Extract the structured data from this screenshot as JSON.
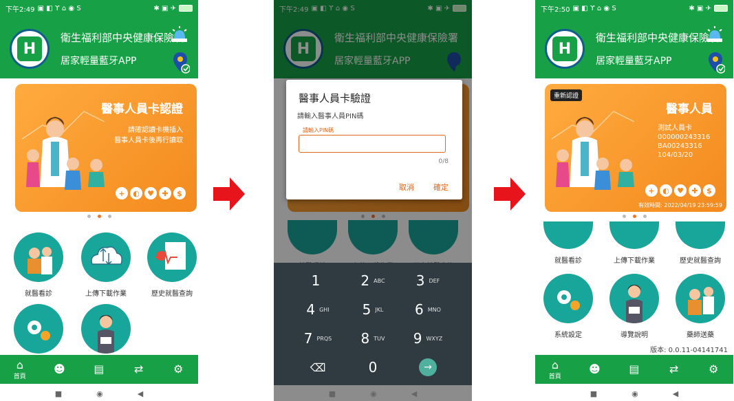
{
  "status": {
    "time_1": "下午2:49",
    "time_2": "下午2:49",
    "time_3": "下午2:50",
    "left_icons": "▣ ◧ ϒ ⌂ ◉ S",
    "right_icons": "✱ ▣ ✈"
  },
  "header": {
    "title": "衛生福利部中央健康保險署",
    "subtitle": "居家輕量藍牙APP",
    "logo_text": "H"
  },
  "screen1": {
    "card_title": "醫事人員卡認證",
    "card_line1": "請確認讀卡機插入",
    "card_line2": "醫事人員卡後再行讀取"
  },
  "screen2": {
    "dialog_title": "醫事人員卡驗證",
    "dialog_message": "請輸入醫事人員PIN碼",
    "input_label": "請輸入PIN碼",
    "char_count": "0/8",
    "cancel": "取消",
    "confirm": "確定",
    "keys": [
      {
        "num": "1",
        "letters": ""
      },
      {
        "num": "2",
        "letters": "ABC"
      },
      {
        "num": "3",
        "letters": "DEF"
      },
      {
        "num": "4",
        "letters": "GHI"
      },
      {
        "num": "5",
        "letters": "JKL"
      },
      {
        "num": "6",
        "letters": "MNO"
      },
      {
        "num": "7",
        "letters": "PRQS"
      },
      {
        "num": "8",
        "letters": "TUV"
      },
      {
        "num": "9",
        "letters": "WXYZ"
      },
      {
        "num": "⌫",
        "letters": ""
      },
      {
        "num": "0",
        "letters": ""
      },
      {
        "num": "→",
        "letters": ""
      }
    ]
  },
  "screen3": {
    "renew": "重新認證",
    "card_title": "醫事人員",
    "card_name": "測試人員卡",
    "card_id1": "000000243316",
    "card_id2": "BA00243316",
    "card_date": "104/03/20",
    "validity": "有效時間: 2022/04/19 23:59:59",
    "version": "版本: 0.0.11-04141741"
  },
  "tiles": {
    "medical_visit": "就醫看診",
    "upload_download": "上傳下載作業",
    "history": "歷史就醫查詢",
    "system_settings": "系統設定",
    "guide": "導覽說明",
    "pharmacist": "藥師送藥"
  },
  "nav": {
    "home": "首頁"
  },
  "colors": {
    "brand_green": "#17a045",
    "card_orange": "#f38a1e",
    "tile_teal": "#19a69a",
    "arrow_red": "#e8141b"
  }
}
